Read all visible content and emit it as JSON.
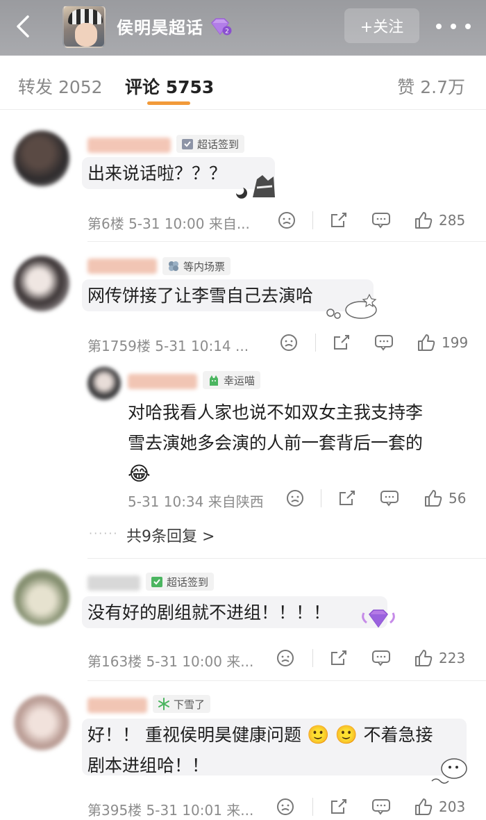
{
  "header": {
    "title": "侯明昊超话",
    "follow_label": "+关注",
    "badge_level": "2"
  },
  "tabs": {
    "repost": "转发 2052",
    "comment": "评论 5753",
    "like": "赞 2.7万"
  },
  "comments": [
    {
      "badge": "超话签到",
      "text": "出来说话啦？？？",
      "meta": "第6楼  5-31 10:00  来自...",
      "likes": "285"
    },
    {
      "badge": "等内场票",
      "text": "网传饼接了让李雪自己去演哈",
      "meta": "第1759楼  5-31 10:14  ...",
      "likes": "199",
      "reply": {
        "badge": "幸运喵",
        "text_line1": "对哈我看人家也说不如双女主我支持李",
        "text_line2": "雪去演她多会演的人前一套背后一套的",
        "emoji": "😂",
        "meta": "5-31 10:34  来自陕西",
        "likes": "56"
      },
      "more_replies": "共9条回复 >"
    },
    {
      "badge": "超话签到",
      "text": "没有好的剧组就不进组！！！！",
      "meta": "第163楼  5-31 10:00  来...",
      "likes": "223"
    },
    {
      "badge": "下雪了",
      "text_line1": "好！！ 重视侯明昊健康问题",
      "text_line1_tail": "不着急接",
      "text_line2": "剧本进组哈！！",
      "meta": "第395楼  5-31 10:01  来...",
      "likes": "203"
    }
  ],
  "colors": {
    "accent": "#f29a3a",
    "header_bg": "#a3a4a8"
  },
  "icons": [
    "back-icon",
    "more-icon",
    "gem-icon",
    "check-in-icon",
    "clover-icon",
    "cat-icon",
    "snowflake-icon",
    "dislike-icon",
    "share-icon",
    "comment-icon",
    "like-icon"
  ]
}
